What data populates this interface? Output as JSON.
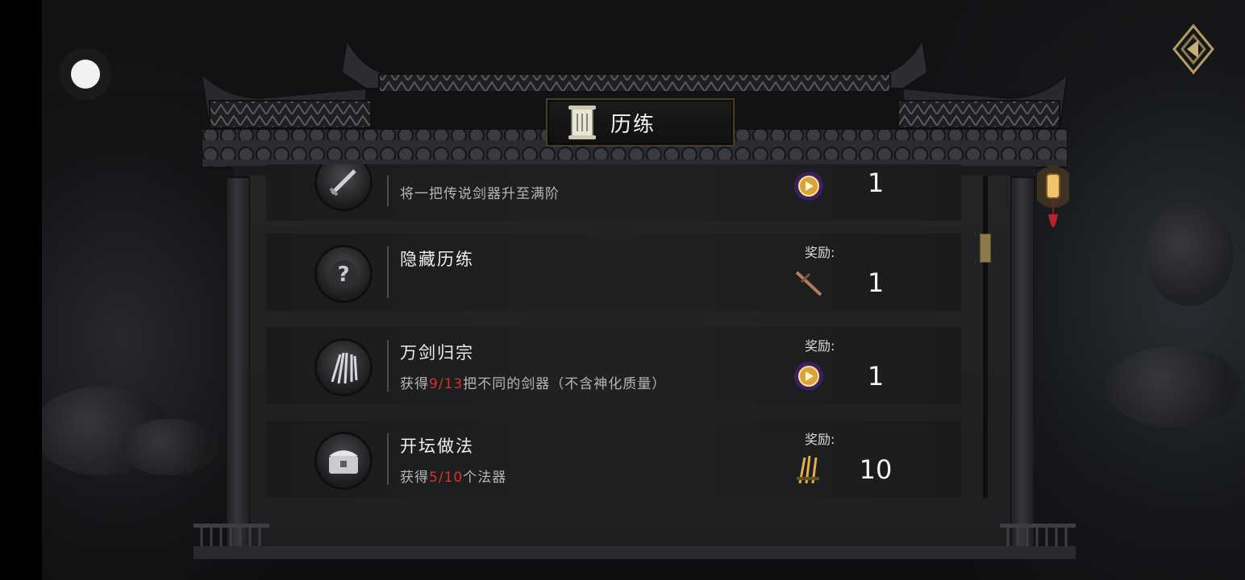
{
  "window": {
    "title": "历练"
  },
  "controls": {
    "menu_button": "circle-button",
    "back_button": "back-diamond-icon"
  },
  "tasks": [
    {
      "name": "",
      "desc_prefix": "将一把传说剑器升至满阶",
      "progress_current": "",
      "progress_total": "",
      "desc_suffix": "",
      "reward_label": "",
      "reward_icon": "purple-orb-icon",
      "reward_count": "1",
      "icon": "sword-icon"
    },
    {
      "name": "隐藏历练",
      "desc_prefix": "",
      "progress_current": "",
      "progress_total": "",
      "desc_suffix": "",
      "reward_label": "奖励:",
      "reward_icon": "bronze-sword-icon",
      "reward_count": "1",
      "icon": "question-icon"
    },
    {
      "name": "万剑归宗",
      "desc_prefix": "获得",
      "progress_current": "9",
      "progress_total": "13",
      "desc_suffix": "把不同的剑器（不含神化质量）",
      "reward_label": "奖励:",
      "reward_icon": "purple-orb-icon",
      "reward_count": "1",
      "icon": "many-swords-icon"
    },
    {
      "name": "开坛做法",
      "desc_prefix": "获得",
      "progress_current": "5",
      "progress_total": "10",
      "desc_suffix": "个法器",
      "reward_label": "奖励:",
      "reward_icon": "golden-daggers-icon",
      "reward_count": "10",
      "icon": "treasure-chest-icon"
    }
  ],
  "colors": {
    "progress_highlight": "#d8322b",
    "accent_gold": "#8d7b4c"
  }
}
